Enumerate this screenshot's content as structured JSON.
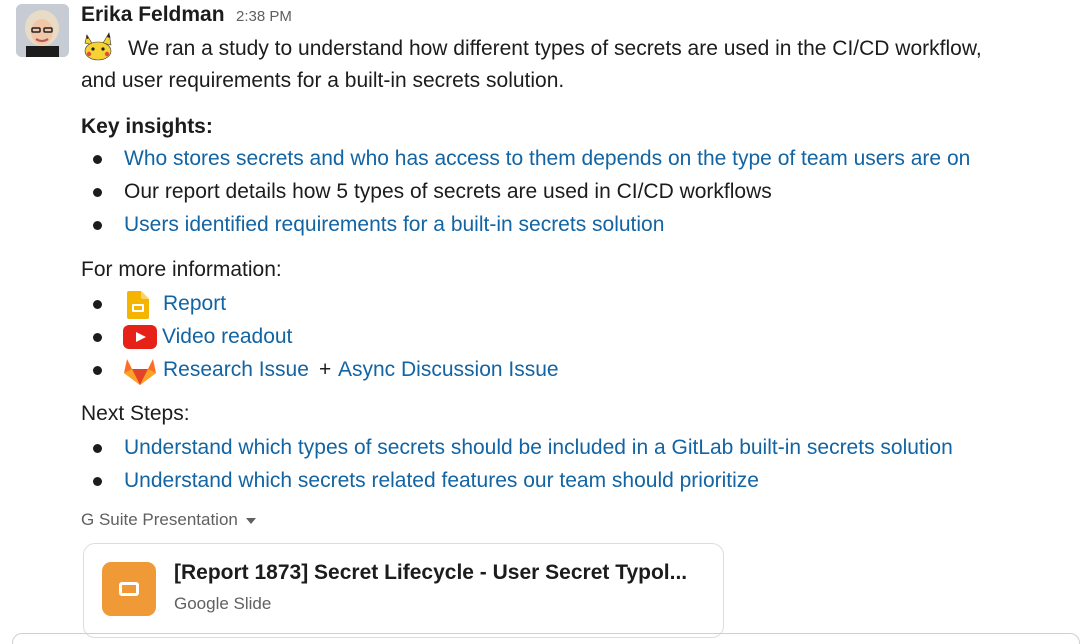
{
  "message": {
    "author": "Erika Feldman",
    "time": "2:38 PM",
    "intro_line1": "We ran a study to understand how different types of secrets are used in the CI/CD workflow,",
    "intro_line2": "and user requirements for a built-in secrets solution.",
    "key_insights_heading": "Key insights:",
    "key_insights": [
      "Who stores secrets and who has access to them depends on the type of team users are on",
      "Our report details how 5 types of secrets are used in CI/CD workflows",
      "Users identified requirements for a built-in secrets solution"
    ],
    "more_info_heading": "For more information:",
    "more_info": {
      "report": "Report",
      "video": "Video readout",
      "research_issue": "Research Issue",
      "plus": "+",
      "async_issue": "Async Discussion Issue"
    },
    "next_steps_heading": "Next Steps:",
    "next_steps": [
      "Understand which types of secrets should be included in a GitLab built-in secrets solution",
      "Understand which secrets related features our team should prioritize"
    ]
  },
  "attachment": {
    "label": "G Suite Presentation",
    "title": "[Report 1873] Secret Lifecycle - User Secret Typol...",
    "subtitle": "Google Slide"
  },
  "icons": {
    "avatar": "user-avatar",
    "emoji": "pikachu-emoji",
    "report": "google-slides-icon",
    "video": "youtube-icon",
    "issue": "gitlab-icon",
    "attachment": "slides-file-icon",
    "caret": "caret-down-icon"
  },
  "colors": {
    "link": "#1264a3",
    "text": "#1d1c1d",
    "muted": "#616061",
    "slides_yellow": "#f4b400",
    "youtube_red": "#e62117",
    "gitlab_orange": "#fc6d26",
    "attachment_orange": "#ef9a36"
  }
}
